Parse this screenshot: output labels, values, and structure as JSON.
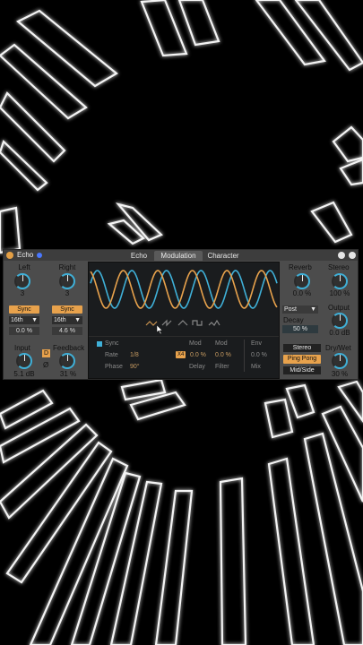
{
  "device": {
    "name": "Echo",
    "tabs": [
      "Echo",
      "Modulation",
      "Character"
    ],
    "active_tab": "Modulation"
  },
  "left": {
    "label": "Left",
    "value": "3",
    "sync_label": "Sync",
    "division": "16th",
    "offset": "0.0 %"
  },
  "right": {
    "label": "Right",
    "value": "3",
    "sync_label": "Sync",
    "division": "16th",
    "offset": "4.6 %"
  },
  "input": {
    "label": "Input",
    "value": "5.1 dB",
    "d_button": "D",
    "phase_symbol": "Ø"
  },
  "feedback": {
    "label": "Feedback",
    "value": "31 %"
  },
  "modulation": {
    "sync_label": "Sync",
    "rate_label": "Rate",
    "rate_value": "1/8",
    "phase_label": "Phase",
    "phase_value": "90°",
    "mod_label_1": "Mod",
    "mod_label_2": "Mod",
    "env_label": "Env",
    "x4_label": "X4",
    "delay_mod_value": "0.0 %",
    "filter_mod_value": "0.0 %",
    "env_mix_value": "0.0 %",
    "delay_label": "Delay",
    "filter_label": "Filter",
    "mix_label": "Mix"
  },
  "reverb": {
    "label": "Reverb",
    "value": "0.0 %",
    "position": "Post",
    "decay_label": "Decay",
    "decay_value": "50 %"
  },
  "stereo": {
    "label": "Stereo",
    "value": "100 %"
  },
  "output": {
    "label": "Output",
    "value": "0.0 dB"
  },
  "dry_wet": {
    "label": "Dry/Wet",
    "value": "30 %"
  },
  "channel_modes": [
    "Stereo",
    "Ping Pong",
    "Mid/Side"
  ],
  "active_channel_mode": "Ping Pong",
  "colors": {
    "accent_orange": "#e8a24c",
    "accent_blue": "#3fb0d8",
    "panel": "#4c4c4c",
    "display_bg": "#1a1c1e"
  },
  "icons": [
    "power-icon",
    "hot-swap-icon",
    "expand-icon",
    "cursor-icon",
    "waveform-shape-icons"
  ]
}
